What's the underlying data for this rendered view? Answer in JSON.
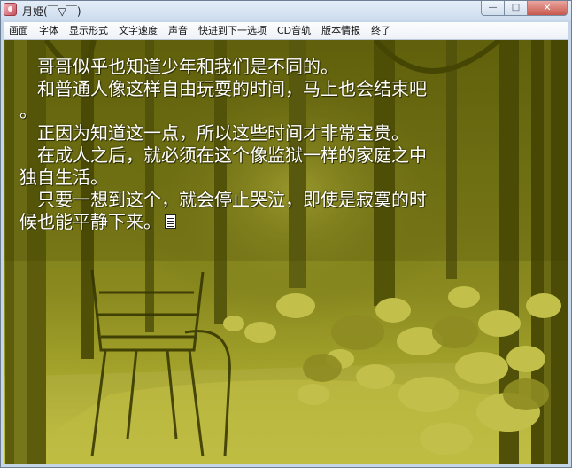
{
  "window": {
    "title": "月姫(￣▽￣)",
    "controls": {
      "minimize": "—",
      "maximize": "□",
      "close": "✕"
    }
  },
  "menu": {
    "items": [
      "画面",
      "字体",
      "显示形式",
      "文字速度",
      "声音",
      "快进到下一选项",
      "CD音轨",
      "版本情报",
      "终了"
    ]
  },
  "scene": {
    "lines": [
      "　哥哥似乎也知道少年和我们是不同的。",
      "　和普通人像这样自由玩耍的时间，马上也会结束吧",
      "。",
      "　正因为知道这一点，所以这些时间才非常宝贵。",
      "　在成人之后，就必须在这个像监狱一样的家庭之中",
      "独自生活。",
      "　只要一想到这个，就会停止哭泣，即使是寂寞的时",
      "候也能平静下来。"
    ],
    "continue_icon": "page-wait-icon",
    "tint_color": "#8a8a20"
  }
}
